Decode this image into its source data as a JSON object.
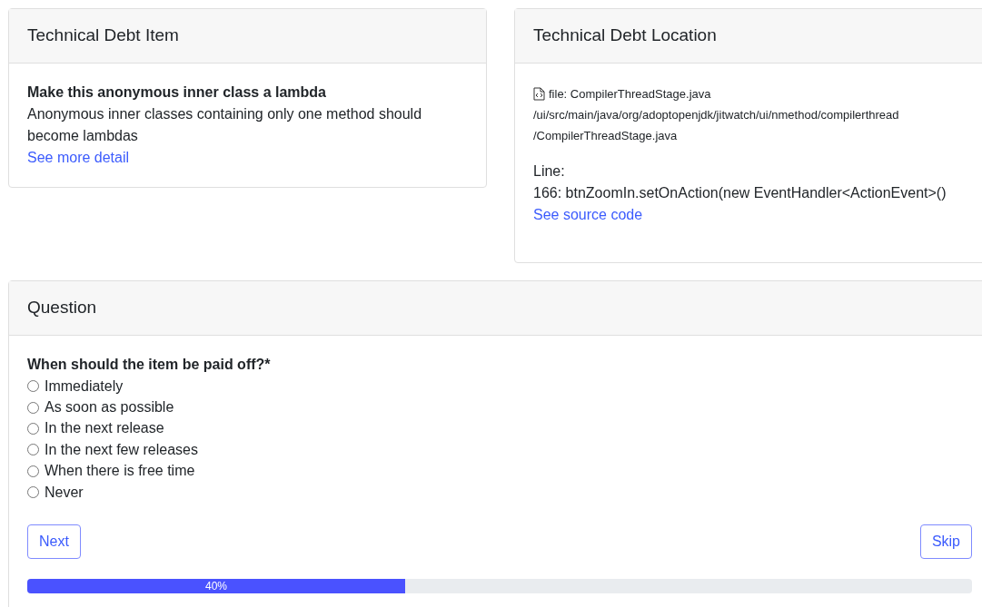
{
  "item_card": {
    "title": "Technical Debt Item",
    "heading": "Make this anonymous inner class a lambda",
    "description": "Anonymous inner classes containing only one method should become lambdas",
    "link": "See more detail"
  },
  "location_card": {
    "title": "Technical Debt Location",
    "file": "file: CompilerThreadStage.java",
    "path_lines": [
      "/ui/src/main/java/org/adoptopenjdk/jitwatch/ui/nmethod/compilerthread",
      "/CompilerThreadStage.java"
    ],
    "line_label": "Line:",
    "line_code": "166: btnZoomIn.setOnAction(new EventHandler<ActionEvent>()",
    "link": "See source code"
  },
  "question_card": {
    "title": "Question",
    "question": "When should the item be paid off?*",
    "options": [
      {
        "label": "Immediately",
        "selected": false
      },
      {
        "label": "As soon as possible",
        "selected": false
      },
      {
        "label": "In the next release",
        "selected": false
      },
      {
        "label": "In the next few releases",
        "selected": false
      },
      {
        "label": "When there is free time",
        "selected": false
      },
      {
        "label": "Never",
        "selected": false
      }
    ],
    "buttons": {
      "next": "Next",
      "skip": "Skip"
    },
    "progress": {
      "level": 0.4,
      "label": "40%"
    }
  }
}
